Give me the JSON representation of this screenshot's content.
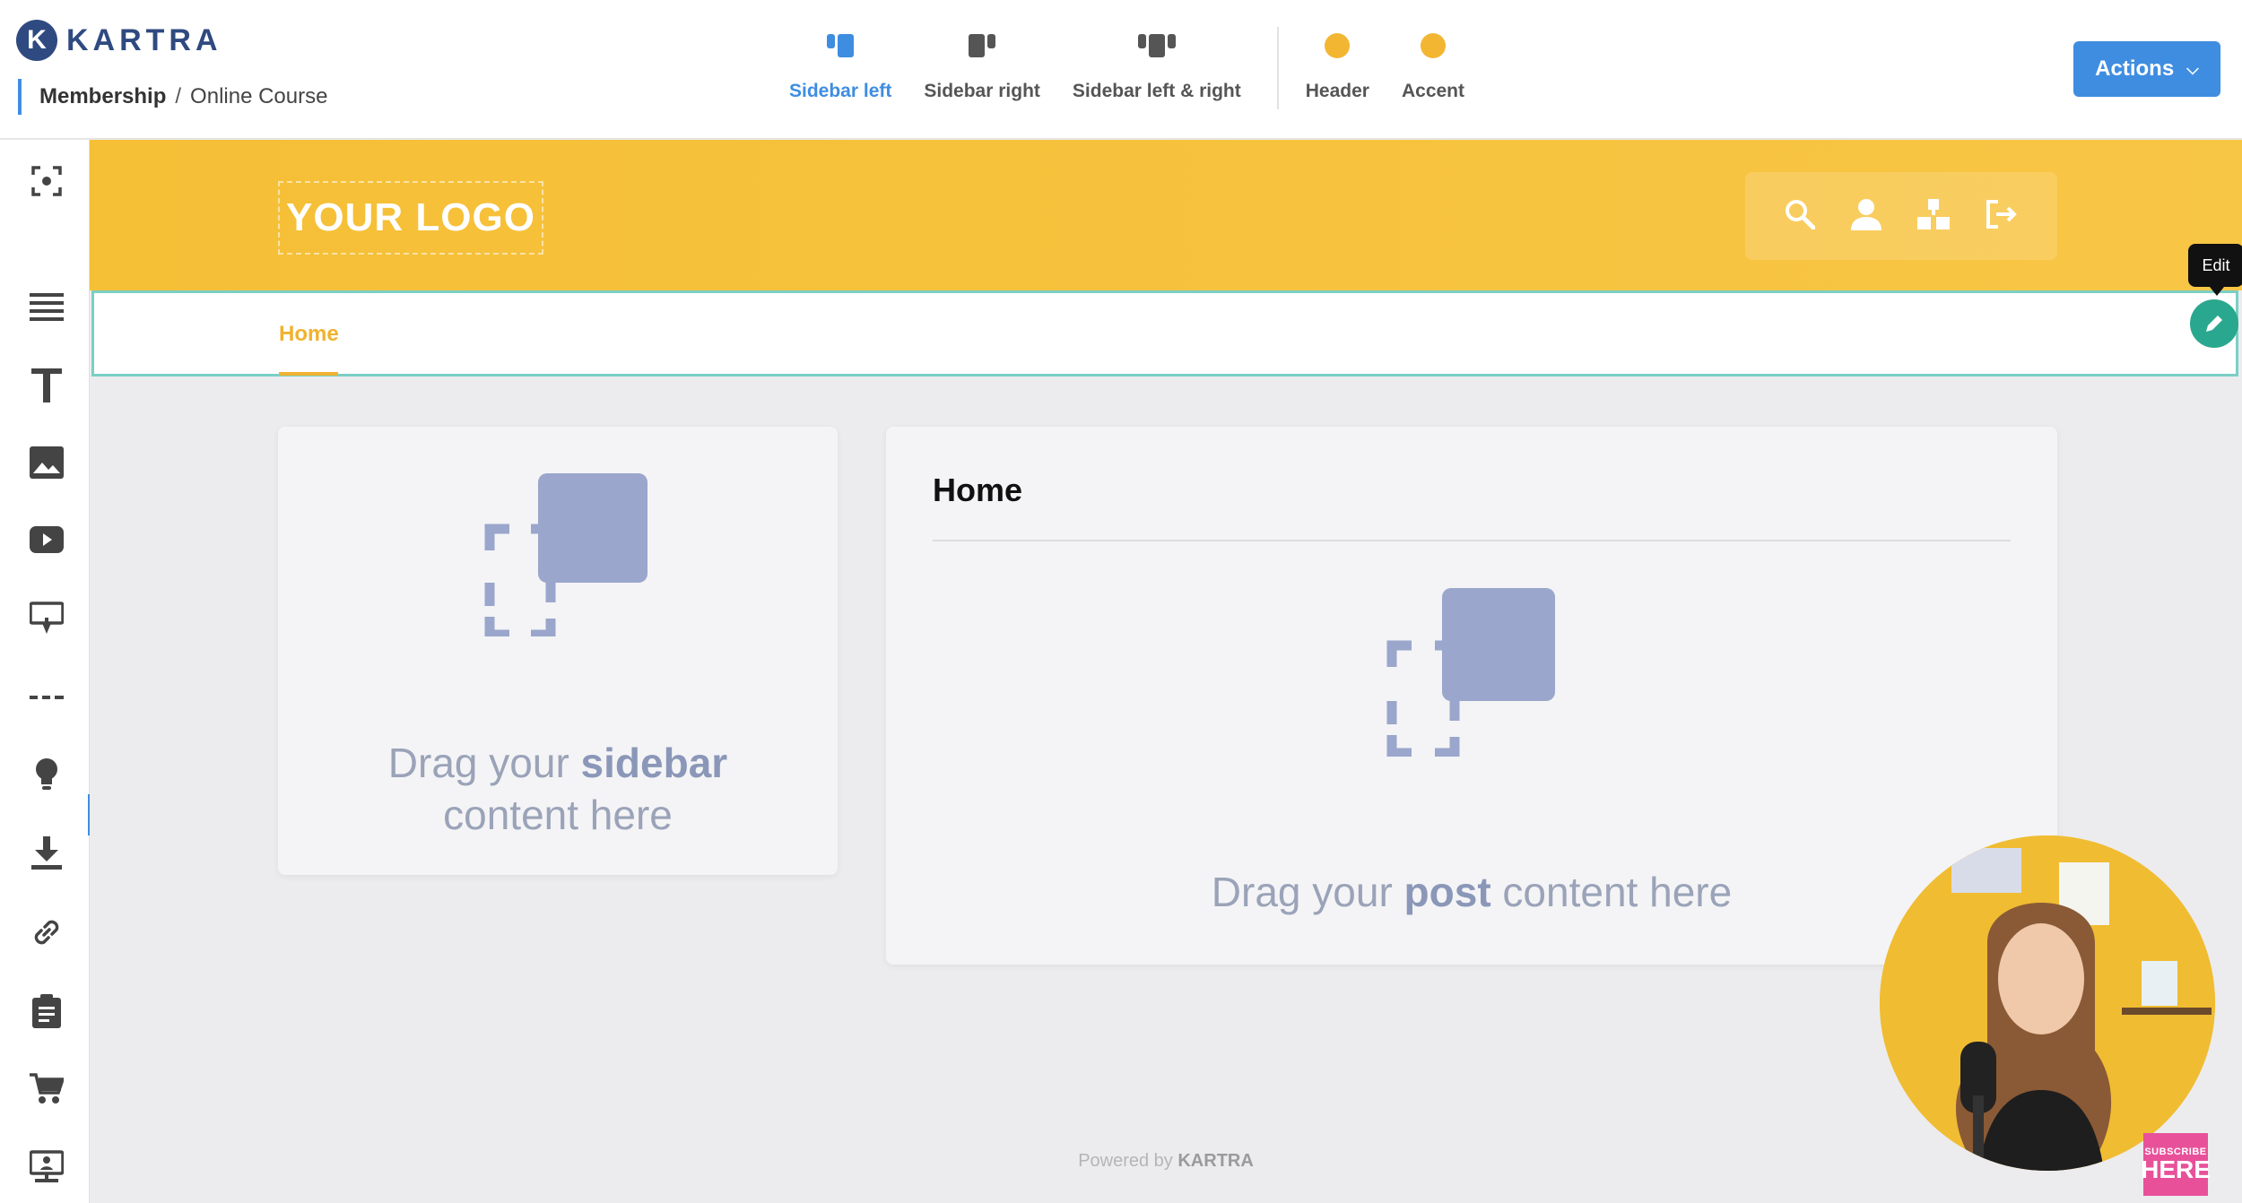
{
  "brand": {
    "mark": "K",
    "name": "KARTRA"
  },
  "breadcrumb": {
    "section": "Membership",
    "separator": "/",
    "page": "Online Course"
  },
  "layout_options": [
    {
      "label": "Sidebar left",
      "active": true
    },
    {
      "label": "Sidebar right",
      "active": false
    },
    {
      "label": "Sidebar left & right",
      "active": false
    }
  ],
  "color_options": [
    {
      "label": "Header",
      "color": "#f2b632"
    },
    {
      "label": "Accent",
      "color": "#f2b632"
    }
  ],
  "actions_button": {
    "label": "Actions"
  },
  "toolbar_icons": [
    "focus-icon",
    "list-icon",
    "text-icon",
    "image-icon",
    "video-icon",
    "embed-icon",
    "divider-icon",
    "bulb-icon",
    "download-icon",
    "link-icon",
    "clipboard-icon",
    "cart-icon",
    "presentation-icon"
  ],
  "site_header": {
    "logo_text": "YOUR LOGO",
    "icons": [
      "search-icon",
      "user-icon",
      "sitemap-icon",
      "logout-icon"
    ]
  },
  "nav": {
    "home_label": "Home"
  },
  "edit_tooltip": "Edit",
  "sidebar_card": {
    "text_before": "Drag your ",
    "text_bold": "sidebar",
    "text_after": "content here"
  },
  "post_card": {
    "title": "Home",
    "text_before": "Drag your ",
    "text_bold": "post",
    "text_after": " content here"
  },
  "footer": {
    "powered_prefix": "Powered by ",
    "powered_brand": "KARTRA"
  },
  "subscribe_badge": {
    "line1": "SUBSCRIBE",
    "line2": "HERE"
  },
  "colors": {
    "primary": "#3f8de0",
    "header_yellow": "#f5bf36",
    "accent": "#f0b230",
    "edit_green": "#2aa88f",
    "placeholder_blue": "#9aa6cc"
  }
}
